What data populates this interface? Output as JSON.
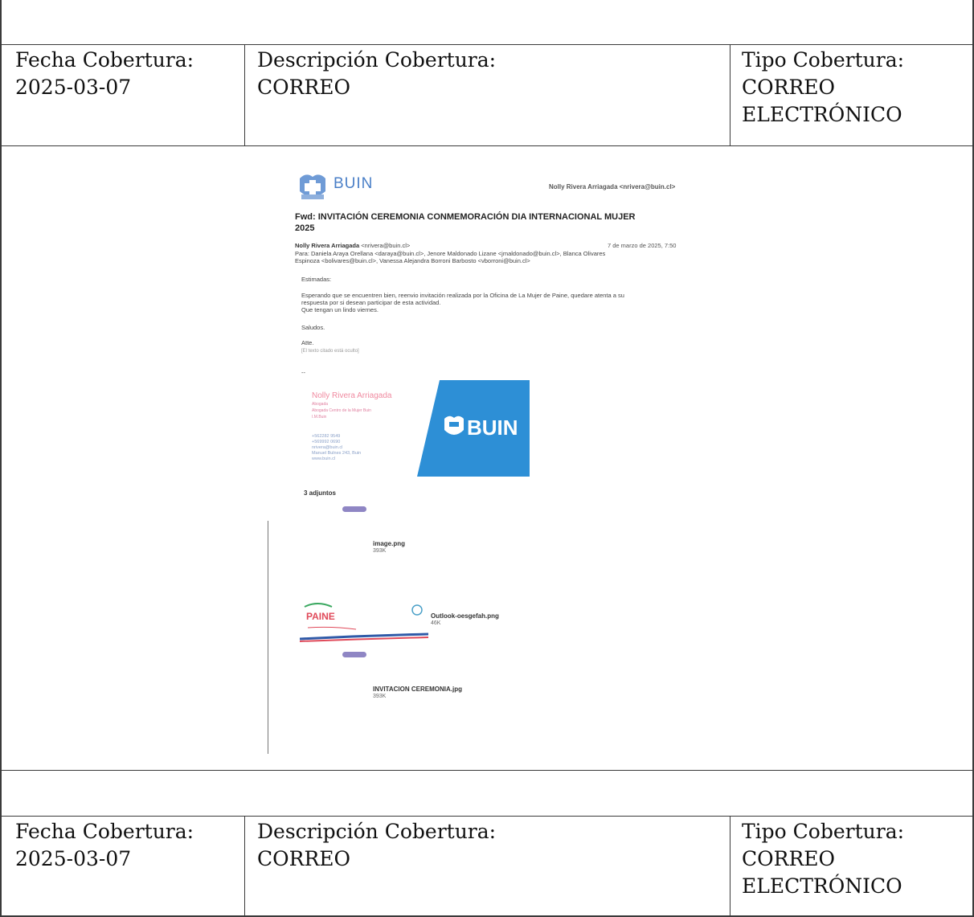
{
  "coverage_blocks": [
    {
      "date_label": "Fecha Cobertura:",
      "date_value": "2025-03-07",
      "desc_label": "Descripción Cobertura:",
      "desc_value": "CORREO",
      "type_label": "Tipo Cobertura:",
      "type_value_line1": "CORREO",
      "type_value_line2": "ELECTRÓNICO"
    },
    {
      "date_label": "Fecha Cobertura:",
      "date_value": "2025-03-07",
      "desc_label": "Descripción Cobertura:",
      "desc_value": "CORREO",
      "type_label": "Tipo Cobertura:",
      "type_value_line1": "CORREO",
      "type_value_line2": "ELECTRÓNICO"
    }
  ],
  "email": {
    "logo_text": "BUIN",
    "sender_header": "Nolly Rivera Arriagada <nrivera@buin.cl>",
    "subject_line1": "Fwd: INVITACIÓN CEREMONIA CONMEMORACIÓN DIA INTERNACIONAL MUJER",
    "subject_line2": "2025",
    "from_name": "Nolly Rivera Arriagada",
    "from_email": "<nrivera@buin.cl>",
    "date": "7 de marzo de 2025, 7:50",
    "to_line1": "Para: Daniela Araya Orellana <daraya@buin.cl>, Jenore Maldonado Lizane <jmaldonado@buin.cl>, Blanca Olivares",
    "to_line2": "Espinoza <bolivares@buin.cl>, Vanessa Alejandra Borroni Barbosto <vborroni@buin.cl>",
    "greeting": "Estimadas:",
    "body_line1": "Esperando que se encuentren bien, reenvio invitación realizada por la Oficina de La Mujer de Paine, quedare atenta a su",
    "body_line2": "respuesta por si desean participar de esta actividad.",
    "body_line3": "Que tengan un lindo viernes.",
    "closing": "Saludos.",
    "signoff": "Atte.",
    "hidden_text": "[El texto citado está oculto]",
    "separator": "--",
    "signature": {
      "name": "Nolly Rivera Arriagada",
      "role": "Abogada",
      "role2": "Abogada Centro de la Mujer Buin",
      "org": "I.M.Buin",
      "phone1": "+562282 9549",
      "phone2": "+569992 0690",
      "email": "nrivera@buin.cl",
      "address": "Manuel Bulnes 243, Buin",
      "web": "www.buin.cl",
      "banner_text": "BUIN"
    },
    "attachments_title": "3 adjuntos",
    "attachments": [
      {
        "name": "image.png",
        "size": "393K"
      },
      {
        "name": "Outlook-oesgefah.png",
        "size": "46K"
      },
      {
        "name": "INVITACION CEREMONIA.jpg",
        "size": "393K"
      }
    ],
    "paine_logo_text": "PAINE",
    "colors": {
      "buin_blue": "#2d8fd6",
      "paine_red": "#e04a5a",
      "logo_blue": "#4a7fc7"
    }
  }
}
